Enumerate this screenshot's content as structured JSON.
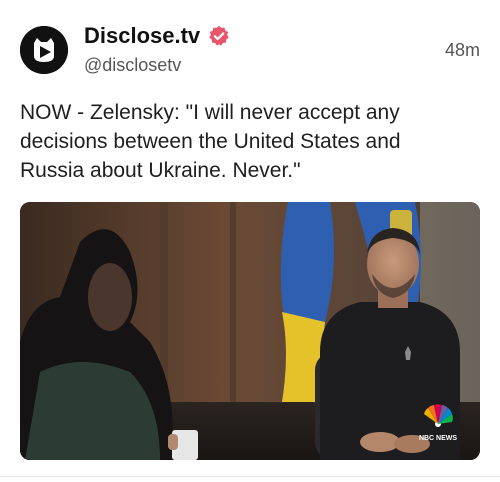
{
  "post": {
    "author": {
      "display_name": "Disclose.tv",
      "handle": "@disclosetv",
      "verified": true,
      "verified_color": "#e8566c",
      "avatar_icon": "disclose-logo-icon"
    },
    "timestamp": "48m",
    "text": "NOW - Zelensky: \"I will never accept any decisions between the United States and Russia about Ukraine. Never.\"",
    "media": {
      "type": "image",
      "watermark": "NBC NEWS"
    }
  },
  "colors": {
    "text": "#1f1f1f",
    "muted": "#555555",
    "avatar_bg": "#111111"
  }
}
